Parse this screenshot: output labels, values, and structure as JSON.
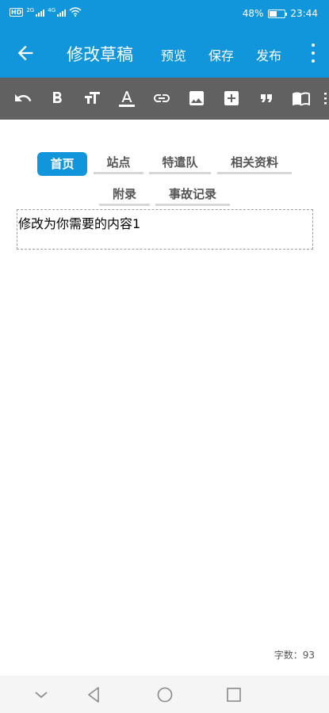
{
  "status_bar": {
    "hd": "HD",
    "net1": "2G",
    "net2": "4G",
    "battery_text": "48%",
    "battery_level": 0.48,
    "time": "23:44"
  },
  "app_bar": {
    "title": "修改草稿",
    "preview_label": "预览",
    "save_label": "保存",
    "publish_label": "发布"
  },
  "toolbar": {
    "tools": [
      "undo-icon",
      "bold-icon",
      "text-size-icon",
      "text-color-icon",
      "link-icon",
      "image-icon",
      "add-box-icon",
      "quote-icon",
      "book-icon",
      "more-icon"
    ]
  },
  "tabs": [
    {
      "label": "首页",
      "active": true
    },
    {
      "label": "站点",
      "active": false
    },
    {
      "label": "特遣队",
      "active": false
    },
    {
      "label": "相关资料",
      "active": false
    },
    {
      "label": "附录",
      "active": false
    },
    {
      "label": "事故记录",
      "active": false
    }
  ],
  "editor": {
    "content": "修改为你需要的内容1"
  },
  "footer": {
    "word_count_label": "字数：93"
  },
  "colors": {
    "primary": "#1296db",
    "toolbar": "#616161"
  }
}
